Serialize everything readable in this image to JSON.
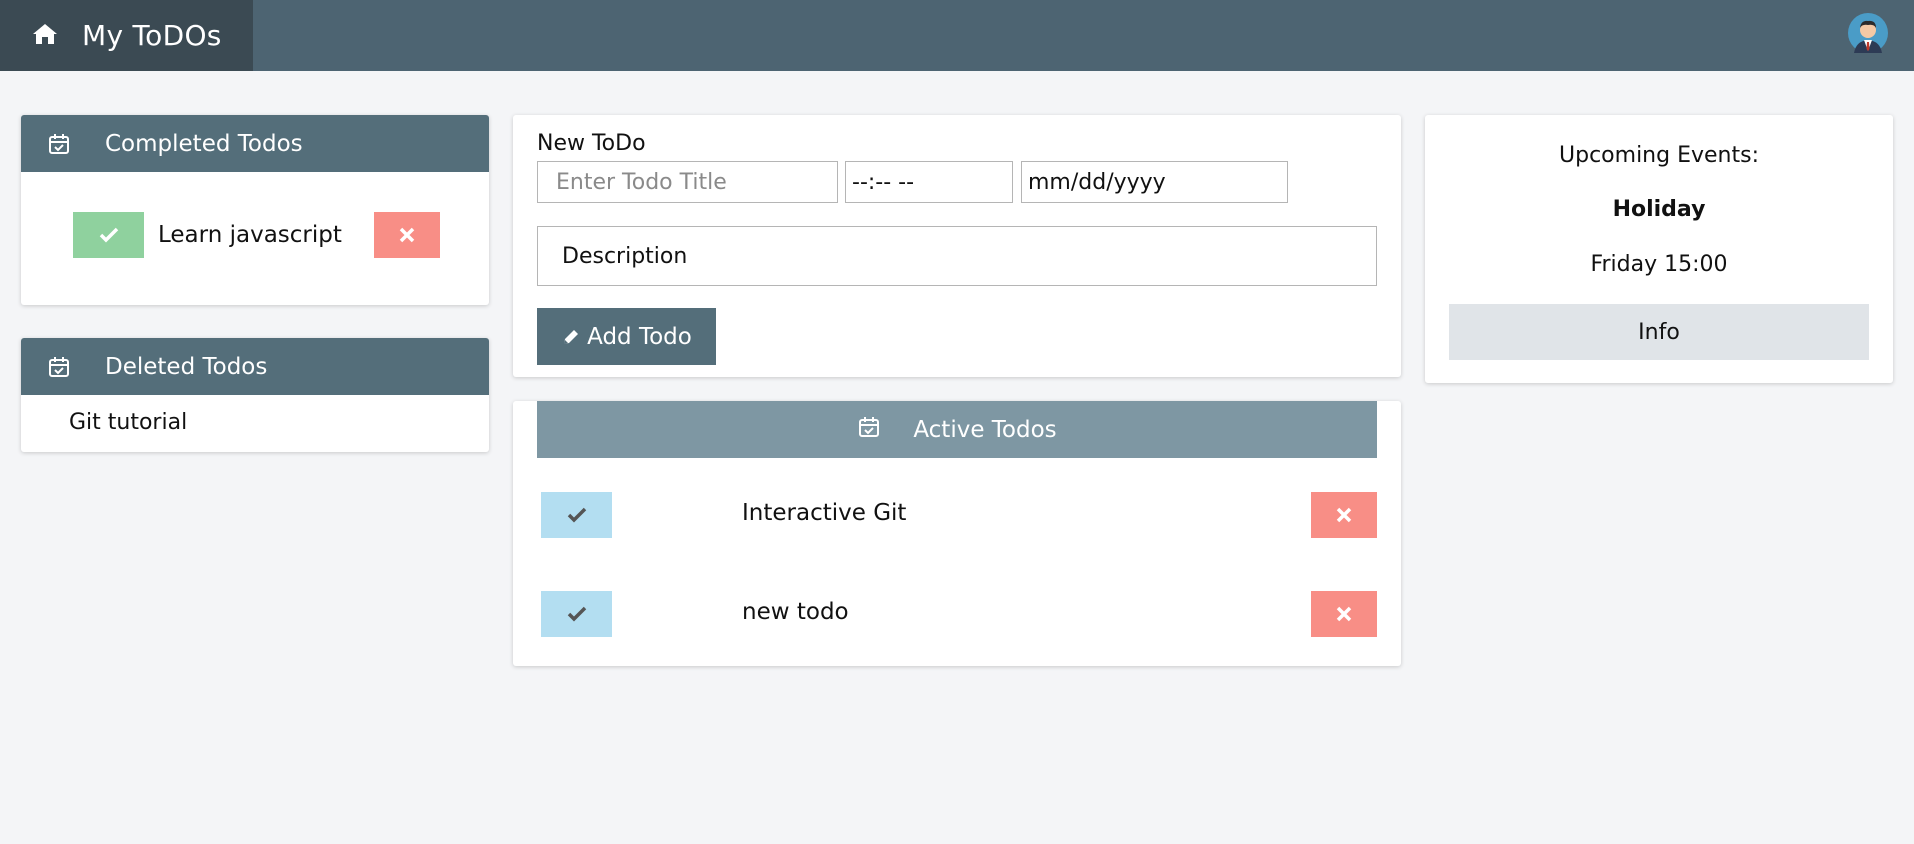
{
  "header": {
    "app_title": "My ToDOs",
    "home_icon": "home-icon",
    "avatar_icon": "user-avatar-icon",
    "bar_color": "#4d6472",
    "home_block_color": "#3b4a53"
  },
  "completed": {
    "title": "Completed Todos",
    "items": [
      {
        "label": "Learn javascript"
      }
    ]
  },
  "deleted": {
    "title": "Deleted Todos",
    "items": [
      {
        "label": "Git tutorial"
      }
    ]
  },
  "new_todo": {
    "heading": "New ToDo",
    "title_placeholder": "Enter Todo Title",
    "time_value": "--:-- --",
    "date_value": "mm/dd/yyyy",
    "description_placeholder": "Description",
    "add_button_label": "Add Todo"
  },
  "active": {
    "title": "Active Todos",
    "items": [
      {
        "label": "Interactive Git"
      },
      {
        "label": "new todo"
      }
    ]
  },
  "events": {
    "title": "Upcoming Events:",
    "event_name": "Holiday",
    "event_time": "Friday 15:00",
    "info_button_label": "Info"
  },
  "colors": {
    "card_header": "#546e7a",
    "active_header": "#7e97a3",
    "check_green": "#8fd19e",
    "check_blue": "#b3def1",
    "delete_red": "#f88e86"
  }
}
